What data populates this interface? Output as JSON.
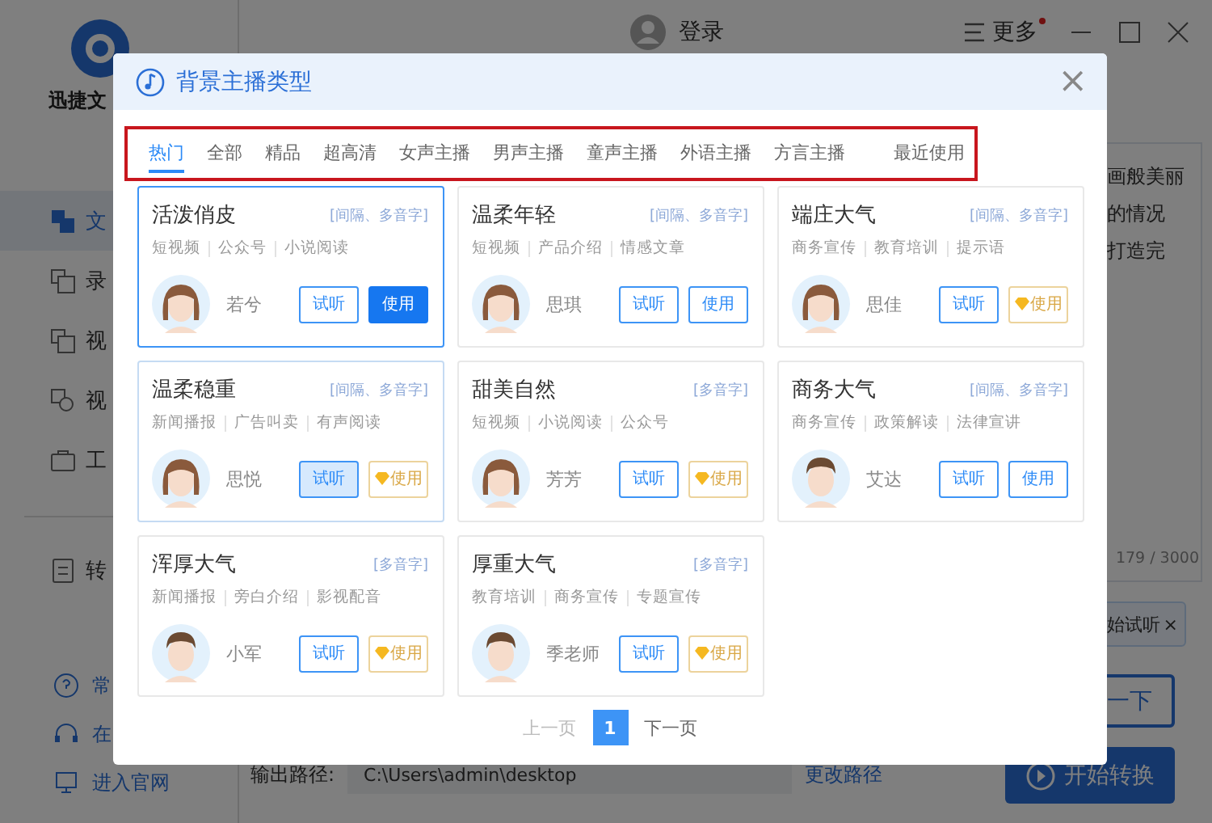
{
  "app": {
    "logo_text": "迅捷文",
    "login": "登录",
    "more": "更多",
    "more_badge": true
  },
  "sidebar": {
    "items": [
      {
        "label": "文",
        "selected": true
      },
      {
        "label": "录",
        "selected": false
      },
      {
        "label": "视",
        "selected": false
      },
      {
        "label": "视",
        "selected": false
      },
      {
        "label": "工",
        "selected": false
      }
    ],
    "convert_item": {
      "label": "转",
      "selected": false
    },
    "footer_links": [
      "常",
      "在",
      "进入官网"
    ]
  },
  "editor": {
    "lines": [
      "画般美丽",
      "的情况",
      "打造完"
    ],
    "counter": "179 / 3000"
  },
  "chip": {
    "label": "始试听",
    "close": "×"
  },
  "try_button": "一下",
  "output": {
    "label": "输出路径:",
    "path": "C:\\Users\\admin\\desktop",
    "change": "更改路径"
  },
  "start_button": "开始转换",
  "dialog": {
    "title": "背景主播类型",
    "close": "×",
    "tabs": [
      {
        "label": "热门",
        "selected": true
      },
      {
        "label": "全部",
        "selected": false
      },
      {
        "label": "精品",
        "selected": false
      },
      {
        "label": "超高清",
        "selected": false
      },
      {
        "label": "女声主播",
        "selected": false
      },
      {
        "label": "男声主播",
        "selected": false
      },
      {
        "label": "童声主播",
        "selected": false
      },
      {
        "label": "外语主播",
        "selected": false
      },
      {
        "label": "方言主播",
        "selected": false
      },
      {
        "label": "最近使用",
        "selected": false
      }
    ],
    "cards": [
      {
        "title": "活泼俏皮",
        "note": "[间隔、多音字]",
        "tags": [
          "短视频",
          "公众号",
          "小说阅读"
        ],
        "name": "若兮",
        "short_hair": false,
        "selected": true,
        "hovered": false,
        "listen": "试听",
        "listen_active": false,
        "use": "使用",
        "use_primary": true,
        "use_vip": false
      },
      {
        "title": "温柔年轻",
        "note": "[间隔、多音字]",
        "tags": [
          "短视频",
          "产品介绍",
          "情感文章"
        ],
        "name": "思琪",
        "short_hair": false,
        "selected": false,
        "hovered": false,
        "listen": "试听",
        "listen_active": false,
        "use": "使用",
        "use_primary": false,
        "use_vip": false
      },
      {
        "title": "端庄大气",
        "note": "[间隔、多音字]",
        "tags": [
          "商务宣传",
          "教育培训",
          "提示语"
        ],
        "name": "思佳",
        "short_hair": false,
        "selected": false,
        "hovered": false,
        "listen": "试听",
        "listen_active": false,
        "use": "使用",
        "use_primary": false,
        "use_vip": true
      },
      {
        "title": "温柔稳重",
        "note": "[间隔、多音字]",
        "tags": [
          "新闻播报",
          "广告叫卖",
          "有声阅读"
        ],
        "name": "思悦",
        "short_hair": false,
        "selected": false,
        "hovered": true,
        "listen": "试听",
        "listen_active": true,
        "use": "使用",
        "use_primary": false,
        "use_vip": true
      },
      {
        "title": "甜美自然",
        "note": "[多音字]",
        "tags": [
          "短视频",
          "小说阅读",
          "公众号"
        ],
        "name": "芳芳",
        "short_hair": false,
        "selected": false,
        "hovered": false,
        "listen": "试听",
        "listen_active": false,
        "use": "使用",
        "use_primary": false,
        "use_vip": true
      },
      {
        "title": "商务大气",
        "note": "[间隔、多音字]",
        "tags": [
          "商务宣传",
          "政策解读",
          "法律宣讲"
        ],
        "name": "艾达",
        "short_hair": true,
        "selected": false,
        "hovered": false,
        "listen": "试听",
        "listen_active": false,
        "use": "使用",
        "use_primary": false,
        "use_vip": false
      },
      {
        "title": "浑厚大气",
        "note": "[多音字]",
        "tags": [
          "新闻播报",
          "旁白介绍",
          "影视配音"
        ],
        "name": "小军",
        "short_hair": true,
        "selected": false,
        "hovered": false,
        "listen": "试听",
        "listen_active": false,
        "use": "使用",
        "use_primary": false,
        "use_vip": true
      },
      {
        "title": "厚重大气",
        "note": "[多音字]",
        "tags": [
          "教育培训",
          "商务宣传",
          "专题宣传"
        ],
        "name": "季老师",
        "short_hair": true,
        "selected": false,
        "hovered": false,
        "listen": "试听",
        "listen_active": false,
        "use": "使用",
        "use_primary": false,
        "use_vip": true
      }
    ],
    "pagination": {
      "prev": "上一页",
      "prev_disabled": true,
      "pages": [
        {
          "label": "1",
          "selected": true
        }
      ],
      "next": "下一页",
      "next_disabled": false
    }
  }
}
